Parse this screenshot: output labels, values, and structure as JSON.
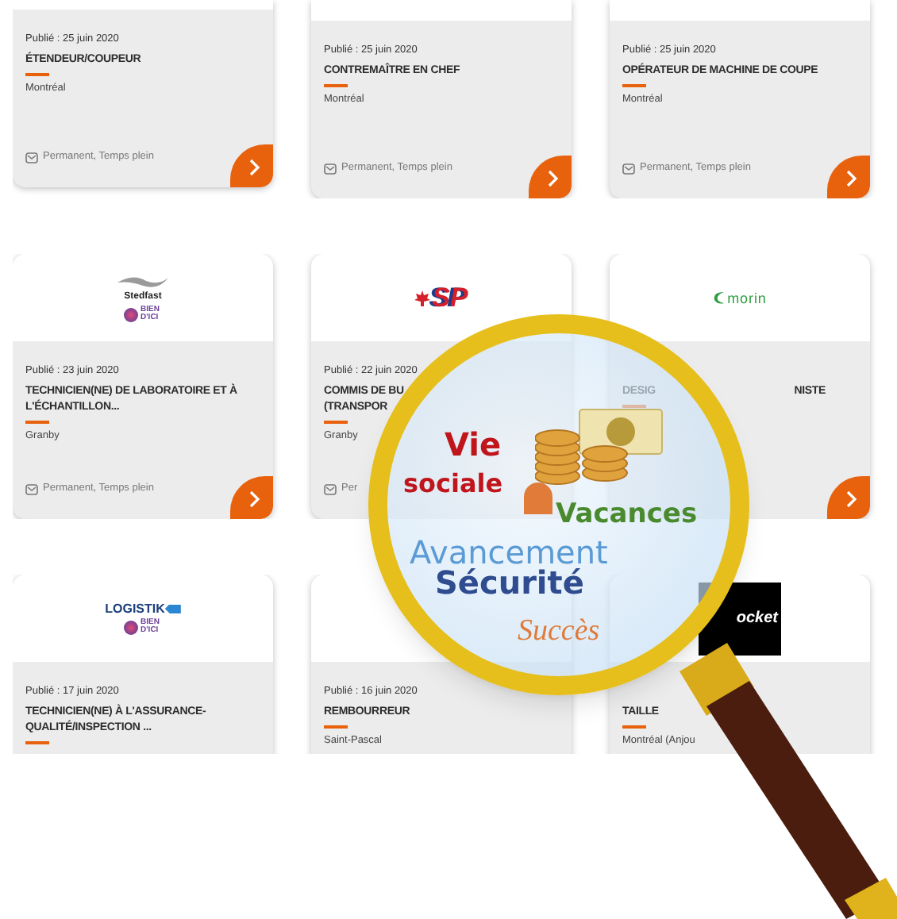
{
  "rows": [
    {
      "cards": [
        {
          "date": "Publié : 25 juin 2020",
          "title_lines": [
            "ÉTENDEUR/COUPEUR"
          ],
          "city": "Montréal",
          "tags": "Permanent, Temps plein",
          "arrow": true
        },
        {
          "date": "Publié : 25 juin 2020",
          "title_lines": [
            "CONTREMAÎTRE EN CHEF"
          ],
          "city": "Montréal",
          "tags": "Permanent, Temps plein",
          "arrow": true
        },
        {
          "date": "Publié : 25 juin 2020",
          "title_lines": [
            "OPÉRATEUR DE MACHINE DE COUPE"
          ],
          "city": "Montréal",
          "tags": "Permanent, Temps plein",
          "arrow": true
        }
      ]
    },
    {
      "cards": [
        {
          "logo": {
            "kind": "stedfast",
            "texts": [
              "Stedfast",
              "BIEN D'ICI"
            ]
          },
          "date": "Publié : 23 juin 2020",
          "title_lines": [
            "TECHNICIEN(NE) DE LABORATOIRE ET À",
            "L'ÉCHANTILLON..."
          ],
          "city": "Granby",
          "tags": "Permanent, Temps plein",
          "arrow": true
        },
        {
          "logo": {
            "kind": "sp",
            "texts": [
              "SP"
            ]
          },
          "date": "Publié : 22 juin 2020",
          "title_lines": [
            "COMMIS DE BU",
            "(TRANSPOR"
          ],
          "city": "Granby",
          "tags": "Per"
        },
        {
          "logo": {
            "kind": "morin",
            "texts": [
              "morin"
            ]
          },
          "title_lines": [
            "DESIG"
          ],
          "title_tail": "NISTE",
          "arrow": true
        }
      ]
    },
    {
      "cards": [
        {
          "logo": {
            "kind": "logistik",
            "texts": [
              "LOGISTIK",
              "BIEN D'ICI"
            ]
          },
          "date": "Publié : 17 juin 2020",
          "title_lines": [
            "TECHNICIEN(NE) À L'ASSURANCE-",
            "QUALITÉ/INSPECTION ..."
          ]
        },
        {
          "logo": {
            "kind": "blank"
          },
          "date": "Publié : 16 juin 2020",
          "title_lines": [
            "REMBOURREUR"
          ],
          "city": "Saint-Pascal"
        },
        {
          "logo": {
            "kind": "rocket",
            "texts": [
              "ocket"
            ]
          },
          "title_lines": [
            "TAILLE"
          ],
          "city": "Montréal (Anjou"
        }
      ]
    }
  ],
  "magnifier": {
    "words": [
      {
        "kind": "vie",
        "text": "Vie"
      },
      {
        "kind": "sociale",
        "text": "sociale"
      },
      {
        "kind": "vacances",
        "text": "Vacances"
      },
      {
        "kind": "avancement",
        "text": "Avancement"
      },
      {
        "kind": "securite",
        "text": "Sécurité"
      },
      {
        "kind": "succes",
        "text": "Succès"
      }
    ]
  }
}
